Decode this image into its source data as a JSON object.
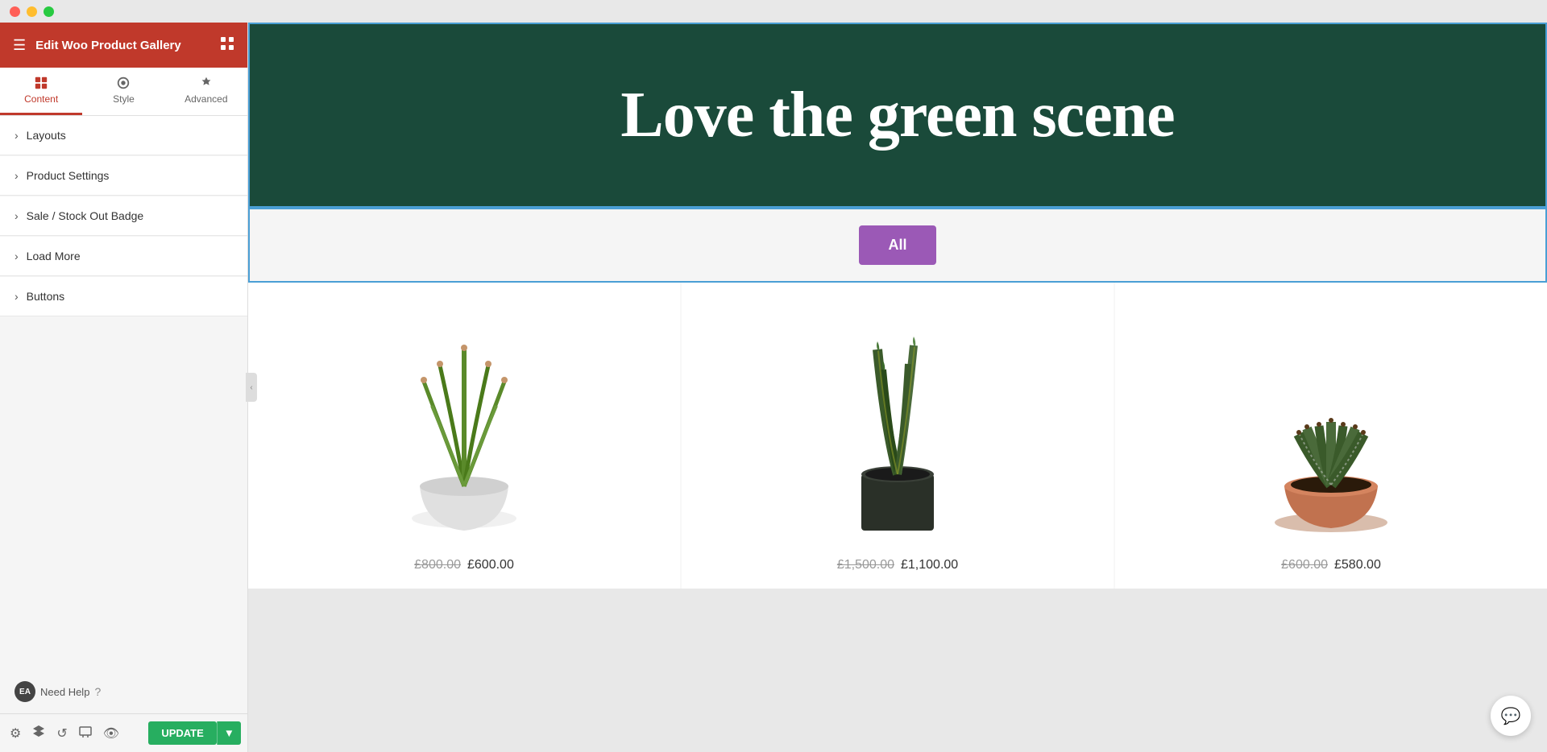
{
  "titlebar": {
    "traffic_lights": [
      "red",
      "yellow",
      "green"
    ]
  },
  "sidebar": {
    "header": {
      "title": "Edit Woo Product Gallery",
      "menu_icon": "☰",
      "grid_icon": "⊞"
    },
    "tabs": [
      {
        "id": "content",
        "label": "Content",
        "active": true
      },
      {
        "id": "style",
        "label": "Style",
        "active": false
      },
      {
        "id": "advanced",
        "label": "Advanced",
        "active": false
      }
    ],
    "items": [
      {
        "id": "layouts",
        "label": "Layouts"
      },
      {
        "id": "product-settings",
        "label": "Product Settings"
      },
      {
        "id": "sale-badge",
        "label": "Sale / Stock Out Badge"
      },
      {
        "id": "load-more",
        "label": "Load More"
      },
      {
        "id": "buttons",
        "label": "Buttons"
      }
    ],
    "footer": {
      "ea_label": "EA",
      "need_help": "Need Help",
      "help_icon": "?"
    },
    "toolbar": {
      "update_label": "UPDATE"
    }
  },
  "main": {
    "hero": {
      "title": "Love the green scene",
      "background_color": "#1a4a3a"
    },
    "filter": {
      "all_label": "All"
    },
    "products": [
      {
        "id": "p1",
        "alt": "Aloe plant in white pot",
        "old_price": "£800.00",
        "new_price": "£600.00",
        "pot_color": "#e8e8e8",
        "plant_type": "aloe"
      },
      {
        "id": "p2",
        "alt": "Tall spiky plant in dark pot",
        "old_price": "£1,500.00",
        "new_price": "£1,100.00",
        "pot_color": "#3a3a3a",
        "plant_type": "sansevieria"
      },
      {
        "id": "p3",
        "alt": "Haworthia in terracotta pot",
        "old_price": "£600.00",
        "new_price": "£580.00",
        "pot_color": "#c1724f",
        "plant_type": "haworthia"
      }
    ]
  },
  "chat": {
    "icon": "💬"
  }
}
